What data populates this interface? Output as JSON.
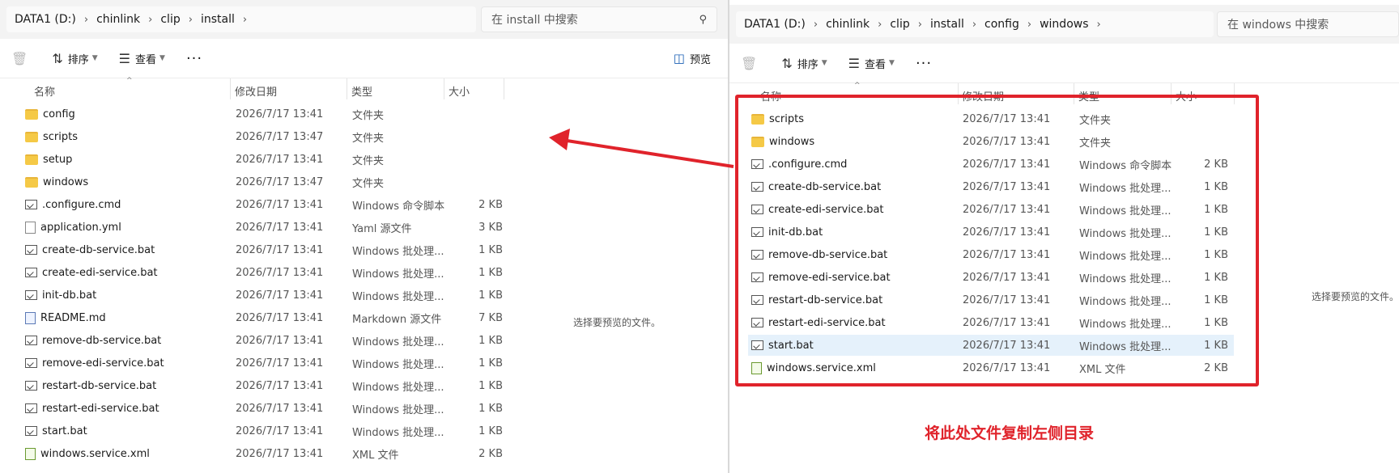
{
  "left": {
    "address": [
      "DATA1 (D:)",
      "chinlink",
      "clip",
      "install"
    ],
    "search_placeholder": "在 install 中搜索",
    "toolbar": {
      "sort": "排序",
      "view": "查看",
      "more": "···",
      "preview": "预览"
    },
    "columns": {
      "name": "名称",
      "date": "修改日期",
      "type": "类型",
      "size": "大小"
    },
    "files": [
      {
        "icon": "folder",
        "name": "config",
        "date": "2026/7/17 13:41",
        "type": "文件夹",
        "size": ""
      },
      {
        "icon": "folder",
        "name": "scripts",
        "date": "2026/7/17 13:47",
        "type": "文件夹",
        "size": ""
      },
      {
        "icon": "folder",
        "name": "setup",
        "date": "2026/7/17 13:41",
        "type": "文件夹",
        "size": ""
      },
      {
        "icon": "folder",
        "name": "windows",
        "date": "2026/7/17 13:47",
        "type": "文件夹",
        "size": ""
      },
      {
        "icon": "bat",
        "name": ".configure.cmd",
        "date": "2026/7/17 13:41",
        "type": "Windows 命令脚本",
        "size": "2 KB"
      },
      {
        "icon": "yml",
        "name": "application.yml",
        "date": "2026/7/17 13:41",
        "type": "Yaml 源文件",
        "size": "3 KB"
      },
      {
        "icon": "bat",
        "name": "create-db-service.bat",
        "date": "2026/7/17 13:41",
        "type": "Windows 批处理...",
        "size": "1 KB"
      },
      {
        "icon": "bat",
        "name": "create-edi-service.bat",
        "date": "2026/7/17 13:41",
        "type": "Windows 批处理...",
        "size": "1 KB"
      },
      {
        "icon": "bat",
        "name": "init-db.bat",
        "date": "2026/7/17 13:41",
        "type": "Windows 批处理...",
        "size": "1 KB"
      },
      {
        "icon": "md",
        "name": "README.md",
        "date": "2026/7/17 13:41",
        "type": "Markdown 源文件",
        "size": "7 KB"
      },
      {
        "icon": "bat",
        "name": "remove-db-service.bat",
        "date": "2026/7/17 13:41",
        "type": "Windows 批处理...",
        "size": "1 KB"
      },
      {
        "icon": "bat",
        "name": "remove-edi-service.bat",
        "date": "2026/7/17 13:41",
        "type": "Windows 批处理...",
        "size": "1 KB"
      },
      {
        "icon": "bat",
        "name": "restart-db-service.bat",
        "date": "2026/7/17 13:41",
        "type": "Windows 批处理...",
        "size": "1 KB"
      },
      {
        "icon": "bat",
        "name": "restart-edi-service.bat",
        "date": "2026/7/17 13:41",
        "type": "Windows 批处理...",
        "size": "1 KB"
      },
      {
        "icon": "bat",
        "name": "start.bat",
        "date": "2026/7/17 13:41",
        "type": "Windows 批处理...",
        "size": "1 KB"
      },
      {
        "icon": "xml",
        "name": "windows.service.xml",
        "date": "2026/7/17 13:41",
        "type": "XML 文件",
        "size": "2 KB"
      }
    ],
    "preview_text": "选择要预览的文件。"
  },
  "right": {
    "address": [
      "DATA1 (D:)",
      "chinlink",
      "clip",
      "install",
      "config",
      "windows"
    ],
    "search_placeholder": "在 windows 中搜索",
    "toolbar": {
      "sort": "排序",
      "view": "查看",
      "more": "···"
    },
    "columns": {
      "name": "名称",
      "date": "修改日期",
      "type": "类型",
      "size": "大小"
    },
    "files": [
      {
        "icon": "folder",
        "name": "scripts",
        "date": "2026/7/17 13:41",
        "type": "文件夹",
        "size": ""
      },
      {
        "icon": "folder",
        "name": "windows",
        "date": "2026/7/17 13:41",
        "type": "文件夹",
        "size": ""
      },
      {
        "icon": "bat",
        "name": ".configure.cmd",
        "date": "2026/7/17 13:41",
        "type": "Windows 命令脚本",
        "size": "2 KB"
      },
      {
        "icon": "bat",
        "name": "create-db-service.bat",
        "date": "2026/7/17 13:41",
        "type": "Windows 批处理...",
        "size": "1 KB"
      },
      {
        "icon": "bat",
        "name": "create-edi-service.bat",
        "date": "2026/7/17 13:41",
        "type": "Windows 批处理...",
        "size": "1 KB"
      },
      {
        "icon": "bat",
        "name": "init-db.bat",
        "date": "2026/7/17 13:41",
        "type": "Windows 批处理...",
        "size": "1 KB"
      },
      {
        "icon": "bat",
        "name": "remove-db-service.bat",
        "date": "2026/7/17 13:41",
        "type": "Windows 批处理...",
        "size": "1 KB"
      },
      {
        "icon": "bat",
        "name": "remove-edi-service.bat",
        "date": "2026/7/17 13:41",
        "type": "Windows 批处理...",
        "size": "1 KB"
      },
      {
        "icon": "bat",
        "name": "restart-db-service.bat",
        "date": "2026/7/17 13:41",
        "type": "Windows 批处理...",
        "size": "1 KB"
      },
      {
        "icon": "bat",
        "name": "restart-edi-service.bat",
        "date": "2026/7/17 13:41",
        "type": "Windows 批处理...",
        "size": "1 KB"
      },
      {
        "icon": "bat",
        "name": "start.bat",
        "date": "2026/7/17 13:41",
        "type": "Windows 批处理...",
        "size": "1 KB",
        "selected": true
      },
      {
        "icon": "xml",
        "name": "windows.service.xml",
        "date": "2026/7/17 13:41",
        "type": "XML 文件",
        "size": "2 KB"
      }
    ],
    "preview_text": "选择要预览的文件。"
  },
  "annotation": {
    "text": "将此处文件复制左侧目录",
    "color": "#e0232b"
  }
}
